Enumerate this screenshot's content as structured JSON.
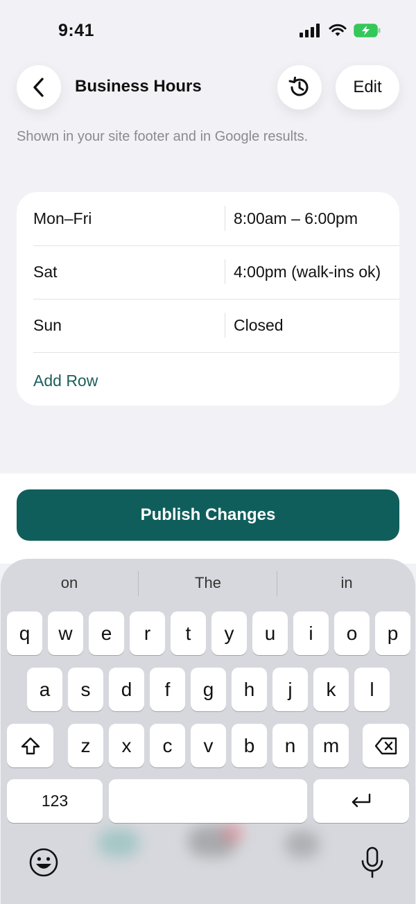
{
  "status": {
    "time": "9:41"
  },
  "header": {
    "title": "Business Hours",
    "edit_label": "Edit",
    "subtitle": "Shown in your site footer and in Google results."
  },
  "hours_table": {
    "rows": [
      {
        "day": "Mon–Fri",
        "hours": "8:00am – 6:00pm"
      },
      {
        "day": "Sat",
        "hours": "4:00pm (walk-ins ok)"
      },
      {
        "day": "Sun",
        "hours": "Closed"
      }
    ],
    "add_row_label": "Add Row"
  },
  "actions": {
    "publish_label": "Publish Changes"
  },
  "keyboard": {
    "suggestions": [
      "on",
      "The",
      "in"
    ],
    "row1": [
      "q",
      "w",
      "e",
      "r",
      "t",
      "y",
      "u",
      "i",
      "o",
      "p"
    ],
    "row2": [
      "a",
      "s",
      "d",
      "f",
      "g",
      "h",
      "j",
      "k",
      "l"
    ],
    "row3": [
      "z",
      "x",
      "c",
      "v",
      "b",
      "n",
      "m"
    ],
    "numbers_label": "123"
  },
  "colors": {
    "accent": "#0f5e5c",
    "link": "#1b5f5c",
    "battery": "#34c759"
  }
}
